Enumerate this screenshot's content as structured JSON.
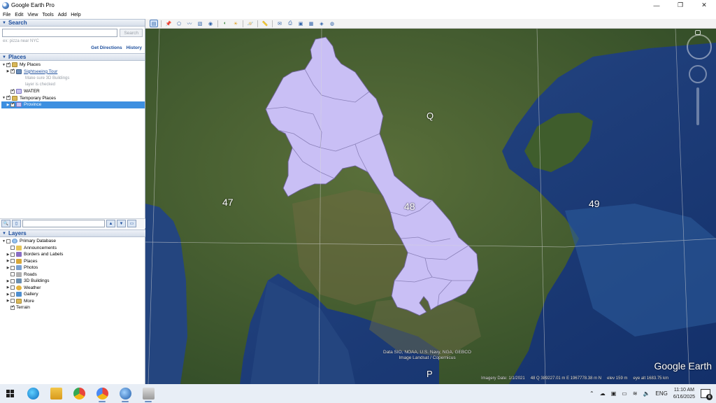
{
  "window": {
    "title": "Google Earth Pro",
    "controls": {
      "minimize": "—",
      "maximize": "❐",
      "close": "✕"
    }
  },
  "menu": [
    "File",
    "Edit",
    "View",
    "Tools",
    "Add",
    "Help"
  ],
  "search": {
    "header": "Search",
    "placeholder": "",
    "button": "Search",
    "hint": "ex: pizza near NYC",
    "links": {
      "directions": "Get Directions",
      "history": "History"
    }
  },
  "places": {
    "header": "Places",
    "items": [
      {
        "label": "My Places"
      },
      {
        "label": "Sightseeing Tour"
      },
      {
        "label": "Make sure 3D Buildings"
      },
      {
        "label": "layer is checked"
      },
      {
        "label": "WATER"
      },
      {
        "label": "Temporary Places"
      },
      {
        "label": "Province"
      }
    ]
  },
  "layers": {
    "header": "Layers",
    "items": [
      {
        "label": "Primary Database"
      },
      {
        "label": "Announcements"
      },
      {
        "label": "Borders and Labels"
      },
      {
        "label": "Places"
      },
      {
        "label": "Photos"
      },
      {
        "label": "Roads"
      },
      {
        "label": "3D Buildings"
      },
      {
        "label": "Weather"
      },
      {
        "label": "Gallery"
      },
      {
        "label": "More"
      },
      {
        "label": "Terrain"
      }
    ]
  },
  "map": {
    "zone_labels": {
      "z47": "47",
      "z48": "48",
      "z49": "49",
      "q": "Q",
      "p": "P"
    },
    "attribution_line1": "Data SIO, NOAA, U.S. Navy, NGA, GEBCO",
    "attribution_line2": "Image Landsat / Copernicus",
    "logo": "Google Earth",
    "status": {
      "imagery_date": "Imagery Date: 1/1/2021",
      "coords": "48 Q 389227.01 m E 1967778.38 m N",
      "elev": "elev   159 m",
      "eye_alt": "eye alt 1683.75 km"
    },
    "colors": {
      "province_fill": "#c9bff5",
      "province_stroke": "#6a6190",
      "sea": "#1f3f78",
      "land": "#3e5a2c"
    }
  },
  "taskbar": {
    "tray": {
      "lang": "ENG",
      "time": "11:10 AM",
      "date": "6/16/2025",
      "notifications": "6"
    }
  }
}
